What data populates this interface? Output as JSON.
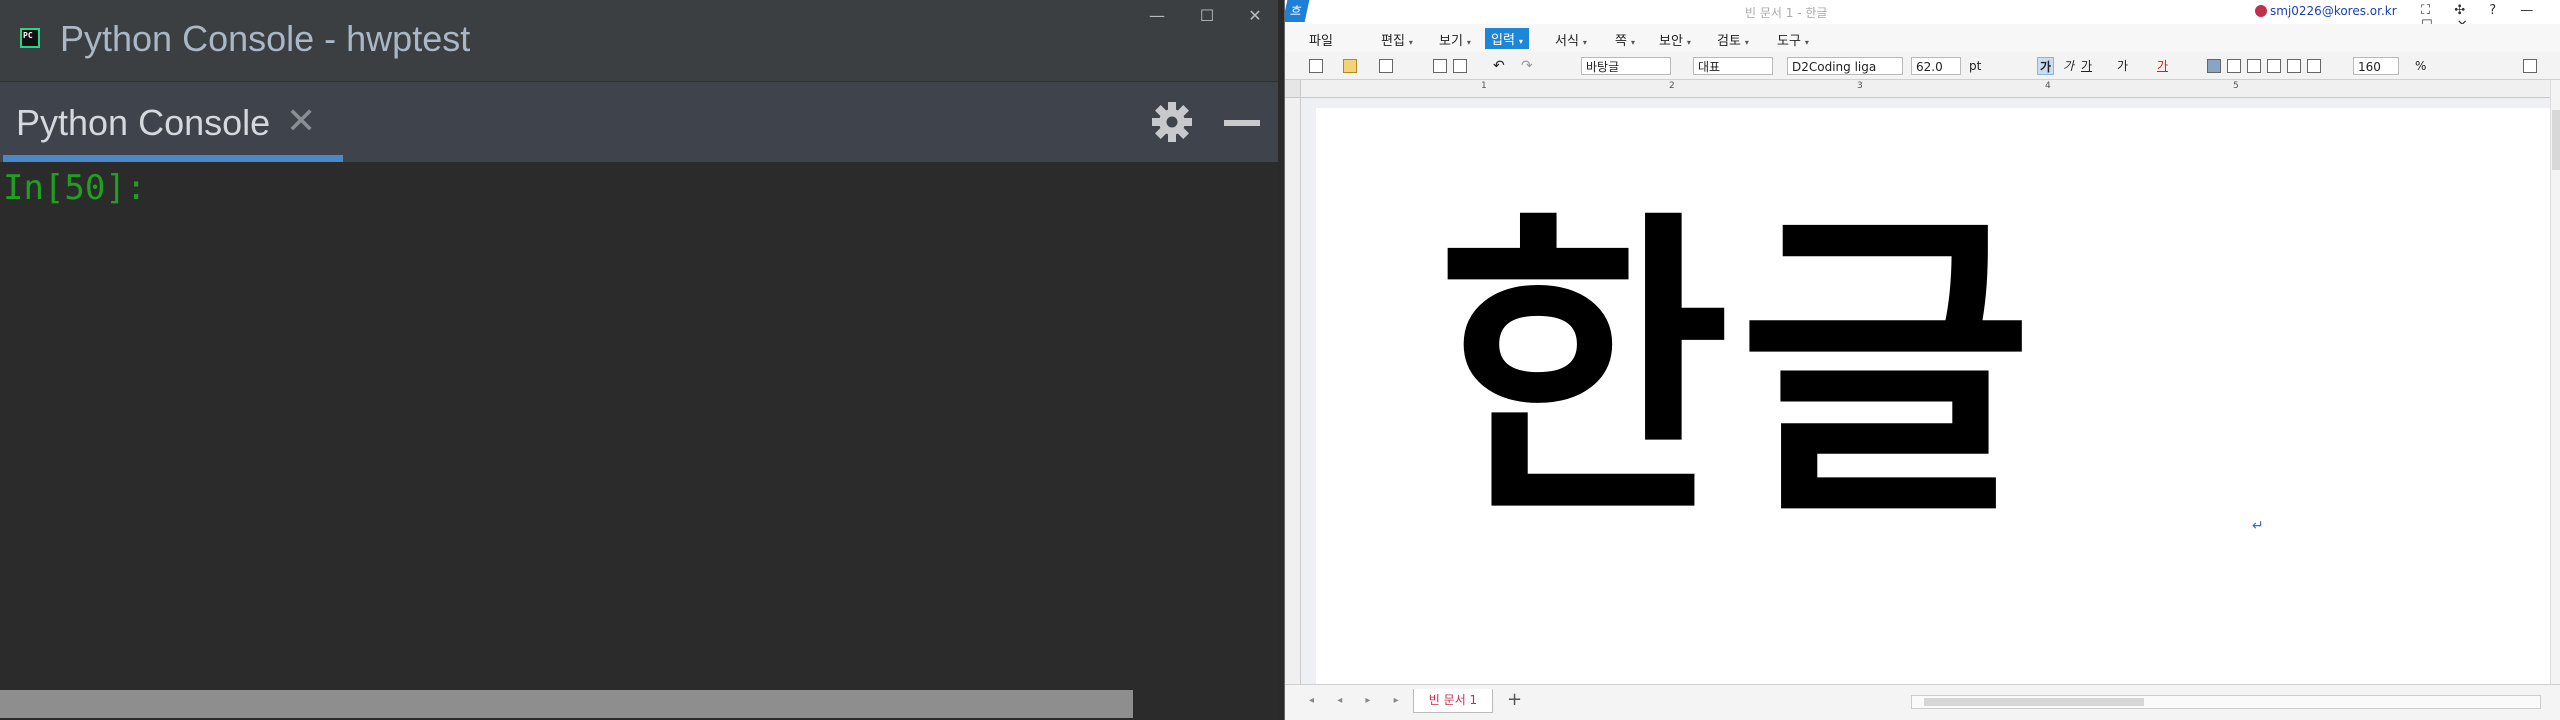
{
  "left_window": {
    "title": "Python Console - hwptest",
    "tab_label": "Python Console",
    "tab_close": "✕",
    "prompt": "In[50]:",
    "controls": {
      "minimize": "—",
      "maximize": "☐",
      "close": "✕"
    }
  },
  "right_window": {
    "logo": "흐",
    "doc_title": "빈 문서 1 - 한글",
    "user": "smj0226@kores.or.kr",
    "title_icons": "⛶ ✣ ? — ☐ ✕",
    "menus": [
      {
        "label": "파일",
        "active": false
      },
      {
        "label": "편집",
        "active": false
      },
      {
        "label": "보기",
        "active": false
      },
      {
        "label": "입력",
        "active": true
      },
      {
        "label": "서식",
        "active": false
      },
      {
        "label": "쪽",
        "active": false
      },
      {
        "label": "보안",
        "active": false
      },
      {
        "label": "검토",
        "active": false
      },
      {
        "label": "도구",
        "active": false
      }
    ],
    "toolbar": {
      "style_name": "바탕글",
      "lang": "대표",
      "font": "D2Coding liga",
      "font_size": "62.0",
      "size_unit": "pt",
      "format_bold": "가",
      "format_italic": "가",
      "format_underline": "가",
      "format_strike": "가",
      "format_color": "가",
      "zoom": "160",
      "zoom_unit": "%"
    },
    "ruler_numbers": [
      "1",
      "2",
      "3",
      "4",
      "5"
    ],
    "document_text": "한글",
    "paragraph_mark": "↵",
    "status": {
      "doc_tab": "빈 문서 1",
      "add_tab": "+",
      "nav": "◂ ◂ ▸ ▸"
    }
  }
}
